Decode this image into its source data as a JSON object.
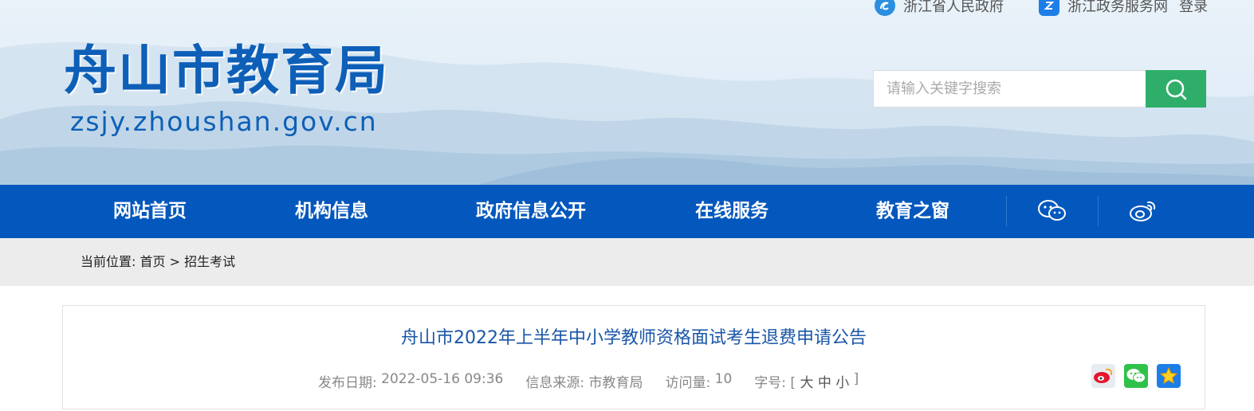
{
  "header": {
    "top_links": [
      {
        "label": "浙江省人民政府",
        "icon": "zhejiang-gov-icon"
      },
      {
        "label": "浙江政务服务网",
        "icon": "zj-service-icon"
      }
    ],
    "login_label": "登录",
    "site_title": "舟山市教育局",
    "site_domain": "zsjy.zhoushan.gov.cn",
    "search": {
      "placeholder": "请输入关键字搜索",
      "value": "",
      "button_icon": "search-icon"
    }
  },
  "nav": {
    "items": [
      {
        "label": "网站首页"
      },
      {
        "label": "机构信息"
      },
      {
        "label": "政府信息公开"
      },
      {
        "label": "在线服务"
      },
      {
        "label": "教育之窗"
      }
    ],
    "icons": [
      "wechat-icon",
      "weibo-icon"
    ]
  },
  "breadcrumb": {
    "prefix": "当前位置: ",
    "home": "首页",
    "separator": " > ",
    "current": "招生考试"
  },
  "article": {
    "title": "舟山市2022年上半年中小学教师资格面试考生退费申请公告",
    "publish_label": "发布日期: ",
    "publish_date": "2022-05-16 09:36",
    "source_label": "信息来源: ",
    "source": "市教育局",
    "views_label": "访问量: ",
    "views": "10",
    "fontsize_label": "字号: [ ",
    "fontsize_large": "大",
    "fontsize_medium": "中",
    "fontsize_small": "小",
    "fontsize_end": " ]",
    "share_icons": [
      "weibo-share-icon",
      "wechat-share-icon",
      "favorite-star-icon"
    ]
  },
  "colors": {
    "nav_bg": "#0458bd",
    "search_btn": "#2fae6a",
    "title_blue": "#0d5fb8",
    "article_title": "#1a56a8"
  }
}
